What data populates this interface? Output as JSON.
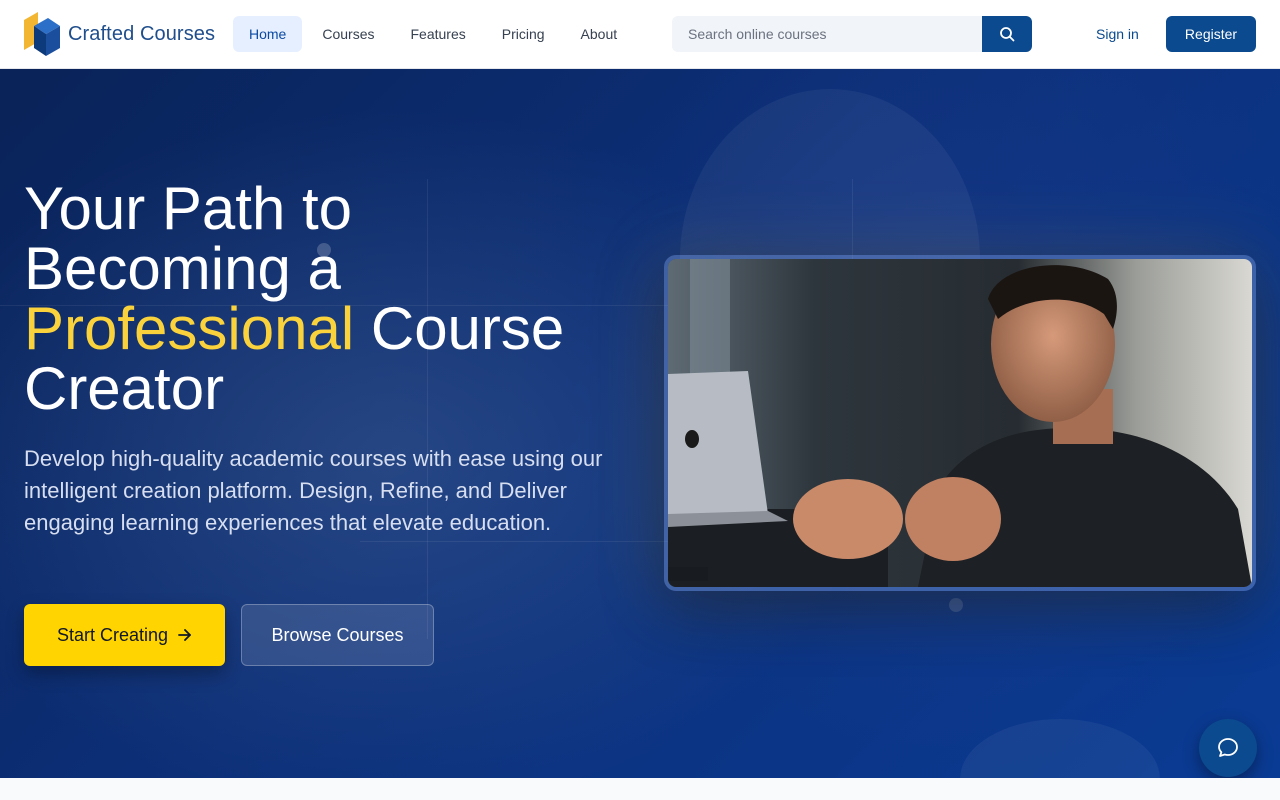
{
  "brand": {
    "name": "Crafted Courses"
  },
  "nav": {
    "items": [
      {
        "label": "Home",
        "active": true
      },
      {
        "label": "Courses",
        "active": false
      },
      {
        "label": "Features",
        "active": false
      },
      {
        "label": "Pricing",
        "active": false
      },
      {
        "label": "About",
        "active": false
      }
    ]
  },
  "search": {
    "placeholder": "Search online courses",
    "value": "",
    "icon": "search-icon"
  },
  "auth": {
    "signin_label": "Sign in",
    "register_label": "Register"
  },
  "hero": {
    "title_line1": "Your Path to",
    "title_line2": "Becoming a",
    "title_highlight": "Professional",
    "title_line3_rest": " Course",
    "title_line4": "Creator",
    "subtitle": "Develop high-quality academic courses with ease using our intelligent creation platform. Design, Refine, and Deliver engaging learning experiences that elevate education.",
    "primary_cta": "Start Creating",
    "secondary_cta": "Browse Courses",
    "primary_cta_icon": "arrow-right-icon"
  },
  "chat": {
    "icon": "chat-bubble-icon"
  },
  "colors": {
    "brand_blue": "#0b4a8e",
    "highlight_yellow": "#f9d23c",
    "cta_yellow": "#ffd400",
    "hero_dark": "#0a2358"
  }
}
